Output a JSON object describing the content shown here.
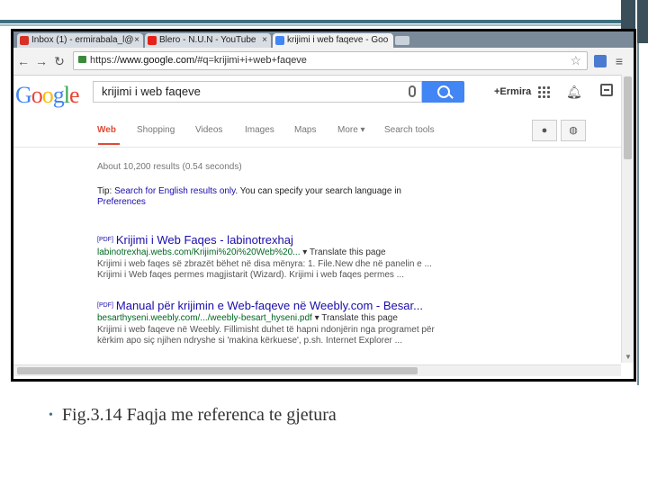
{
  "browser": {
    "tabs": [
      {
        "label": "Inbox (1) - ermirabala_l@",
        "close": "×",
        "active": false,
        "favicon_color": "#d93025",
        "favicon": "gmail-icon"
      },
      {
        "label": "Blero - N.U.N - YouTube",
        "close": "×",
        "active": false,
        "favicon_color": "#e62117",
        "favicon": "youtube-icon"
      },
      {
        "label": "krijimi i web faqeve - Goo",
        "close": "×",
        "active": true,
        "favicon_color": "#4285f4",
        "favicon": "google-icon"
      }
    ],
    "url_scheme": "https://",
    "url_host": "www.google.com",
    "url_path": "/#q=krijimi+i+web+faqeve"
  },
  "google": {
    "logo": "Google",
    "query": "krijimi i web faqeve",
    "user": "+Ermira",
    "nav_tabs": [
      "Web",
      "Shopping",
      "Videos",
      "Images",
      "Maps",
      "More ▾",
      "Search tools"
    ],
    "active_tab": "Web",
    "stats": "About 10,200 results (0.54 seconds)",
    "tip_prefix": "Tip:",
    "tip_link": "Search for English results only",
    "tip_rest": ". You can specify your search language in",
    "tip_link2": "Preferences"
  },
  "results": [
    {
      "pdf": "[PDF]",
      "title": "Krijimi i Web Faqes - labinotrexhaj",
      "url": "labinotrexhaj.webs.com/Krijimi%20i%20Web%20...",
      "translate": "▾ Translate this page",
      "snippet1": "Krijimi i web faqes së zbrazët bëhet në disa mënyra: 1. File.New dhe në panelin e ...",
      "snippet2": "Krijimi i Web faqes permes magjistarit (Wizard). Krijimi i web faqes permes ..."
    },
    {
      "pdf": "[PDF]",
      "title": "Manual për krijimin e Web-faqeve në Weebly.com - Besar...",
      "url": "besarthyseni.weebly.com/.../weebly-besart_hyseni.pdf",
      "translate": "▾ Translate this page",
      "snippet1": "Krijimi i web faqeve në Weebly. Fillimisht duhet të hapni ndonjërin nga programet për",
      "snippet2": "kërkim apo siç njihen ndryshe si 'makina kërkuese', p.sh. Internet Explorer ..."
    }
  ],
  "caption": {
    "bullet": "•",
    "text": "Fig.3.14 Faqja me referenca te gjetura"
  },
  "colors": {
    "google_blue": "#4285f4",
    "google_red": "#dd4b39",
    "link": "#1a0dab",
    "url_green": "#006621",
    "slide_accent": "#3f6f7f"
  }
}
